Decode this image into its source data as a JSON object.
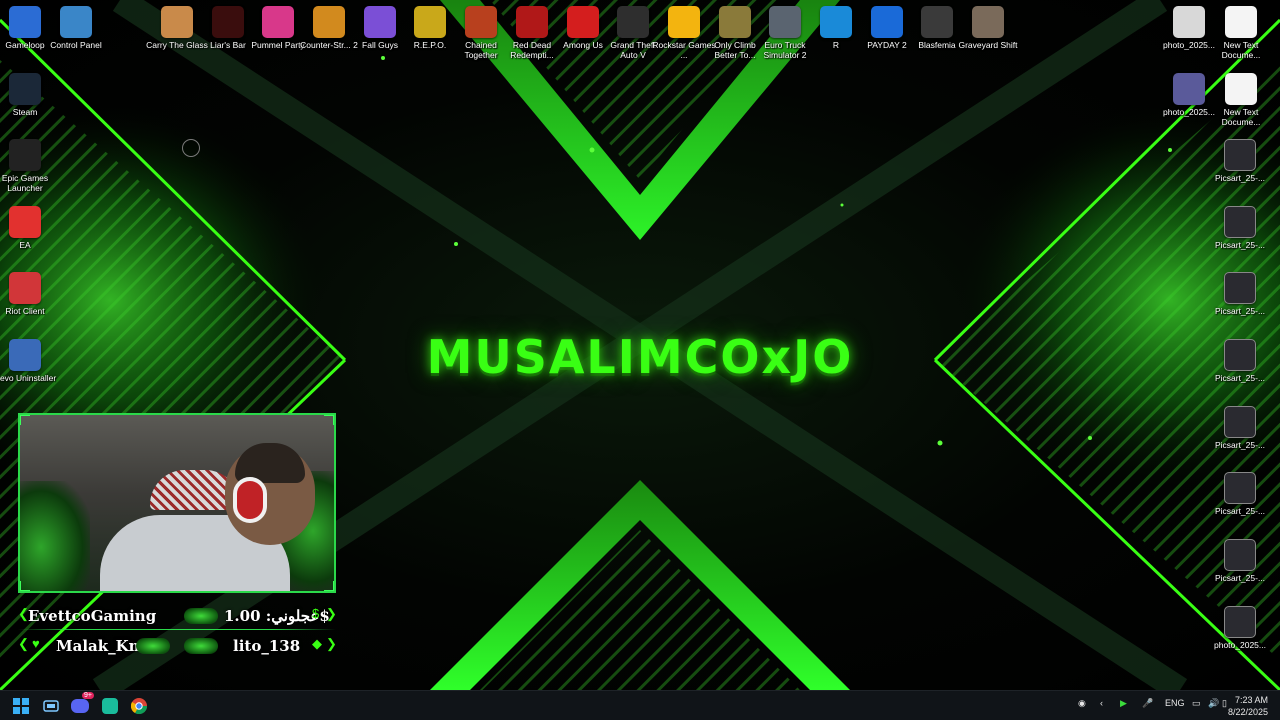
{
  "wallpaper": {
    "title": "MUSALIMCOxJO",
    "accent": "#39ff14"
  },
  "desktop_icons_top": [
    {
      "label": "Gameloop",
      "icon": "gameloop-icon",
      "color": "#2b6cd4"
    },
    {
      "label": "Control Panel",
      "icon": "control-panel-icon",
      "color": "#3a86c8"
    },
    {
      "label": "Carry The Glass",
      "icon": "carry-the-glass-icon",
      "color": "#c98a4a"
    },
    {
      "label": "Liar's Bar",
      "icon": "liars-bar-icon",
      "color": "#3a0d0d"
    },
    {
      "label": "Pummel Party",
      "icon": "pummel-party-icon",
      "color": "#d8388a"
    },
    {
      "label": "Counter-Str... 2",
      "icon": "counter-strike-2-icon",
      "color": "#d28a1e"
    },
    {
      "label": "Fall Guys",
      "icon": "fall-guys-icon",
      "color": "#7b4fd6"
    },
    {
      "label": "R.E.P.O.",
      "icon": "repo-icon",
      "color": "#c9a81a"
    },
    {
      "label": "Chained Together",
      "icon": "chained-together-icon",
      "color": "#b8401e"
    },
    {
      "label": "Red Dead Redempti...",
      "icon": "red-dead-redemption-icon",
      "color": "#b01818"
    },
    {
      "label": "Among Us",
      "icon": "among-us-icon",
      "color": "#d41e1e"
    },
    {
      "label": "Grand Theft Auto V",
      "icon": "gta-v-icon",
      "color": "#2e2e2e"
    },
    {
      "label": "Rockstar Games ...",
      "icon": "rockstar-games-icon",
      "color": "#f3b40f"
    },
    {
      "label": "Only Climb Better To...",
      "icon": "only-climb-icon",
      "color": "#8a7a3a"
    },
    {
      "label": "Euro Truck Simulator 2",
      "icon": "euro-truck-simulator-icon",
      "color": "#5a6470"
    },
    {
      "label": "R",
      "icon": "rocket-league-icon",
      "color": "#1a8ad8"
    },
    {
      "label": "PAYDAY 2",
      "icon": "payday-2-icon",
      "color": "#1a6ad8"
    },
    {
      "label": "Blasfemia",
      "icon": "blasfemia-icon",
      "color": "#3a3a3a"
    },
    {
      "label": "Graveyard Shift",
      "icon": "graveyard-shift-icon",
      "color": "#7a6a5a"
    }
  ],
  "desktop_icons_left": [
    {
      "label": "Steam",
      "icon": "steam-icon",
      "color": "#1b2838"
    },
    {
      "label": "Epic Games Launcher",
      "icon": "epic-games-icon",
      "color": "#222222"
    },
    {
      "label": "EA",
      "icon": "ea-icon",
      "color": "#e2312f"
    },
    {
      "label": "Riot Client",
      "icon": "riot-client-icon",
      "color": "#d13639"
    },
    {
      "label": "Revo Uninstaller",
      "icon": "revo-uninstaller-icon",
      "color": "#3a6ab8"
    }
  ],
  "desktop_icons_right_top": [
    {
      "label": "photo_2025...",
      "icon": "photo-icon",
      "color": "#d8d8d8"
    },
    {
      "label": "New Text Docume...",
      "icon": "text-document-icon",
      "color": "#f4f4f4"
    },
    {
      "label": "photo_2025...",
      "icon": "photo-icon",
      "color": "#5a5a9a"
    },
    {
      "label": "New Text Docume...",
      "icon": "text-document-icon",
      "color": "#f4f4f4"
    }
  ],
  "desktop_icons_right": [
    {
      "label": "Picsart_25-...",
      "icon": "picsart-image-icon"
    },
    {
      "label": "Picsart_25-...",
      "icon": "picsart-image-icon"
    },
    {
      "label": "Picsart_25-...",
      "icon": "picsart-image-icon"
    },
    {
      "label": "Picsart_25-...",
      "icon": "picsart-image-icon"
    },
    {
      "label": "Picsart_25-...",
      "icon": "picsart-image-icon"
    },
    {
      "label": "Picsart_25-...",
      "icon": "picsart-image-icon"
    },
    {
      "label": "Picsart_25-...",
      "icon": "picsart-image-icon"
    },
    {
      "label": "photo_2025...",
      "icon": "photo-icon"
    }
  ],
  "donations": {
    "row1": {
      "name": "EvettcoGaming",
      "message": "عجلوني: 1.00$"
    },
    "row2": {
      "name": "Malak_Kn",
      "message": "lito_138"
    }
  },
  "taskbar": {
    "language": "ENG",
    "time": "7:23 AM",
    "date": "8/22/2025",
    "discord_badge": "9+"
  }
}
